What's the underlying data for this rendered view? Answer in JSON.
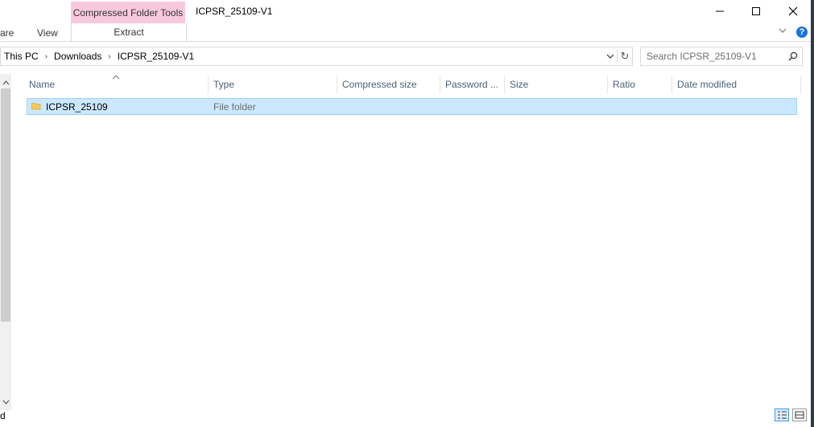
{
  "window": {
    "title": "ICPSR_25109-V1",
    "context_tab": "Compressed Folder Tools",
    "controls": {
      "minimize": "—",
      "maximize": "☐",
      "close": "✕"
    }
  },
  "ribbon": {
    "tabs": [
      "are",
      "View"
    ],
    "context_subtab": "Extract",
    "collapse_glyph": "⌵",
    "help_glyph": "?"
  },
  "address_bar": {
    "breadcrumbs": [
      "This PC",
      "Downloads",
      "ICPSR_25109-V1"
    ],
    "separator": "›",
    "dropdown_glyph": "⌵",
    "refresh_glyph": "↻"
  },
  "search": {
    "placeholder": "Search ICPSR_25109-V1",
    "icon": "search-icon"
  },
  "columns": [
    "Name",
    "Type",
    "Compressed size",
    "Password ...",
    "Size",
    "Ratio",
    "Date modified"
  ],
  "sort_glyph": "^",
  "files": [
    {
      "name": "ICPSR_25109",
      "type": "File folder",
      "icon": "folder-icon"
    }
  ],
  "left_pane_text": "d",
  "scroll": {
    "up": "^",
    "down": "⌄"
  },
  "colors": {
    "accent": "#1a73d9",
    "context_tab": "#f8c9dc",
    "selection": "#cce8ff"
  }
}
